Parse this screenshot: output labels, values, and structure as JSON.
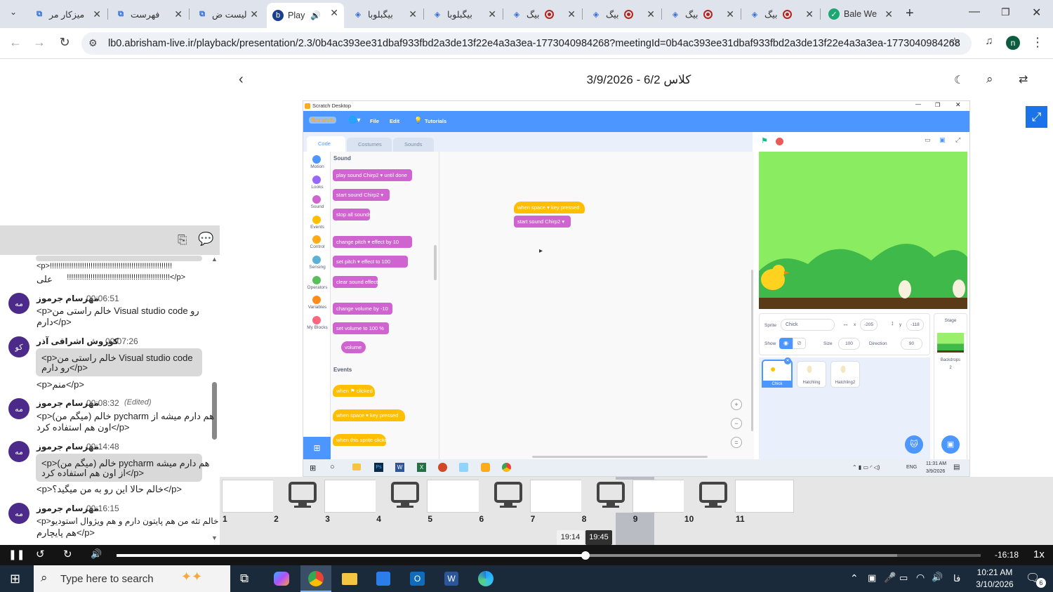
{
  "browser": {
    "tabs": [
      {
        "label": "میزکار مر",
        "icon": "scratch-blue-icon"
      },
      {
        "label": "فهرست",
        "icon": "scratch-blue-icon"
      },
      {
        "label": "لیست ض",
        "icon": "scratch-blue-icon"
      },
      {
        "label": "Play",
        "icon": "playback-icon",
        "active": true
      },
      {
        "label": "بیگبلوبا",
        "icon": "bluebutton-icon"
      },
      {
        "label": "بیگبلوبا",
        "icon": "bluebutton-icon"
      },
      {
        "label": "بیگ",
        "icon": "bluebutton-icon"
      },
      {
        "label": "بیگ",
        "icon": "bluebutton-icon"
      },
      {
        "label": "بیگ",
        "icon": "bluebutton-icon"
      },
      {
        "label": "بیگ",
        "icon": "bluebutton-icon"
      },
      {
        "label": "Bale We",
        "icon": "bale-icon"
      }
    ],
    "url": "lb0.abrisham-live.ir/playback/presentation/2.3/0b4ac393ee31dbaf933fbd2a3de13f22e4a3a3ea-1773040984268?meetingId=0b4ac393ee31dbaf933fbd2a3de13f22e4a3a3ea-1773040984268",
    "profile_initial": "n"
  },
  "presentation": {
    "title": "کلاس 6/2 - 3/9/2026"
  },
  "chat": {
    "messages": [
      {
        "lines": [
          "<p>!!!!!!!!!!!!!!!!!!!!!!!!!!!!!!!!!!!!!!!!!!!!!!!!!!!!!!!!!",
          "!!!!!!!!!!!!!!!!!!!!!!!!!!!!!!!!!!!!!!!!!!!!!!!!</p>",
          "علی"
        ]
      },
      {
        "avatar": "مه",
        "name": "مهرسام جرموز",
        "time": "00:06:51",
        "lines": [
          "<p>خالم راستی من Visual studio code رو",
          "دارم</p>"
        ]
      },
      {
        "avatar": "کو",
        "name": "کوروش اشراقی آذر",
        "time": "00:07:26",
        "lines": [
          "<p>خالم راستی من Visual studio code",
          "رو دارم</p>",
          "<p>منم</p>"
        ]
      },
      {
        "avatar": "مه",
        "name": "مهرسام جرموز",
        "time": "00:08:32",
        "edited": "(Edited)",
        "lines": [
          "<p>(میگم من) خالم pycharm هم دارم میشه از",
          "اون هم استفاده کرد</p>"
        ]
      },
      {
        "avatar": "مه",
        "name": "مهرسام جرموز",
        "time": "00:14:48",
        "lines": [
          "<p>(میگم من) خالم pycharm هم دارم میشه",
          "از اون هم استفاده کرد</p>",
          "<p>خالم حالا این رو به من میگید؟</p>"
        ]
      },
      {
        "avatar": "مه",
        "name": "مهرسام جرموز",
        "time": "00:16:15",
        "lines": [
          "<p>خالم تئه من هم پایتون دارم و هم ویژوال استودیو",
          "هم پایچارم</p>"
        ]
      }
    ]
  },
  "scratch": {
    "window_title": "Scratch Desktop",
    "logo": "Scratch",
    "menu": [
      "File",
      "Edit",
      "Tutorials"
    ],
    "tabs": [
      "Code",
      "Costumes",
      "Sounds"
    ],
    "categories": [
      {
        "label": "Motion",
        "color": "#4c97ff"
      },
      {
        "label": "Looks",
        "color": "#9966ff"
      },
      {
        "label": "Sound",
        "color": "#cf63cf"
      },
      {
        "label": "Events",
        "color": "#ffbf00"
      },
      {
        "label": "Control",
        "color": "#ffab19"
      },
      {
        "label": "Sensing",
        "color": "#5cb1d6"
      },
      {
        "label": "Operators",
        "color": "#59c059"
      },
      {
        "label": "Variables",
        "color": "#ff8c1a"
      },
      {
        "label": "My Blocks",
        "color": "#ff6680"
      }
    ],
    "palette_sound_heading": "Sound",
    "palette_events_heading": "Events",
    "blocks_sound": [
      "play sound  Chirp2 ▾  until done",
      "start sound  Chirp2 ▾",
      "stop all sounds",
      "change  pitch ▾  effect by  10",
      "set  pitch ▾  effect to  100",
      "clear sound effects",
      "change volume by  -10",
      "set volume to  100  %",
      "volume"
    ],
    "blocks_events": [
      "when  ⚑  clicked",
      "when  space ▾  key pressed",
      "when this sprite clicked"
    ],
    "script": [
      "when  space ▾  key pressed",
      "start sound  Chirp2 ▾"
    ],
    "sprite_info": {
      "sprite_label": "Sprite",
      "sprite_name": "Chick",
      "x_label": "x",
      "x": "-205",
      "y_label": "y",
      "y": "-118",
      "show_label": "Show",
      "size_label": "Size",
      "size": "100",
      "direction_label": "Direction",
      "direction": "90"
    },
    "sprites": [
      "Chick",
      "Hatchling",
      "Hatchling2"
    ],
    "stage_panel": {
      "label": "Stage",
      "backdrops_label": "Backdrops",
      "backdrops_count": "2"
    },
    "inner_taskbar": {
      "lang": "ENG",
      "time": "11:31 AM",
      "date": "3/9/2026"
    }
  },
  "thumbnails": [
    "1",
    "2",
    "3",
    "4",
    "5",
    "6",
    "7",
    "8",
    "9",
    "10",
    "11"
  ],
  "player": {
    "hover_time": "19:14",
    "current_time": "19:45",
    "remaining": "-16:18",
    "speed": "1x",
    "progress": 0.543
  },
  "taskbar": {
    "search_placeholder": "Type here to search",
    "time": "10:21 AM",
    "date": "3/10/2026",
    "lang": "فا",
    "notifications": "6"
  },
  "colors": {
    "accent_purple": "#4b2a8a",
    "scratch_blue": "#4c97ff",
    "player_bg": "#141414",
    "taskbar_bg": "#1b2a3a"
  }
}
